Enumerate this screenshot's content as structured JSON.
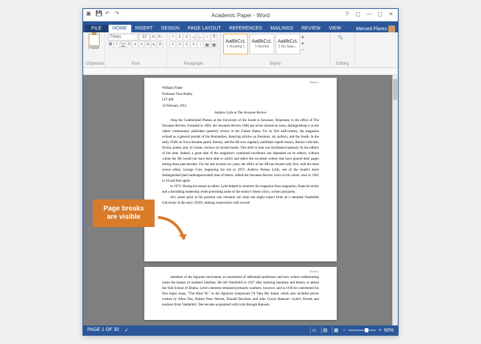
{
  "window": {
    "title": "Academic Paper - Word",
    "user": "Merced Flores"
  },
  "tabs": [
    "FILE",
    "HOME",
    "INSERT",
    "DESIGN",
    "PAGE LAYOUT",
    "REFERENCES",
    "MAILINGS",
    "REVIEW",
    "VIEW"
  ],
  "ribbon": {
    "clipboard": {
      "paste": "Paste",
      "label": "Clipboard"
    },
    "font": {
      "name": "Times",
      "size": "12",
      "label": "Font"
    },
    "paragraph": {
      "label": "Paragraph"
    },
    "styles": {
      "items": [
        {
          "sample": "AaBbCcL",
          "name": "1 Heading 1"
        },
        {
          "sample": "AaBbCcL",
          "name": "1 Normal"
        },
        {
          "sample": "AaBbCcL",
          "name": "1 No Spac..."
        }
      ],
      "label": "Styles"
    },
    "editing": {
      "label": "Editing"
    }
  },
  "document": {
    "folio1": "Fisher 1",
    "folio2": "Fisher 2",
    "header": [
      "William Fisher",
      "Professor Tom Shelby",
      "LIT 498",
      "12 February 2013"
    ],
    "title_prefix": "Andrew Lytle at ",
    "title_italic": "The Sewanee Review",
    "body1": "Atop the Cumberland Plateau at the University of the South in Sewanee, Tennessee, is the office of The Sewanee Review. Founded in 1892, the Sewanee Review (SR) has never missed an issue, distinguishing it as the oldest continuously published quarterly review in the United States. For its first half-century, the magazine existed as a general journal of the Humanities, featuring articles on literature, art, politics, and the South. In the early 1940s its focus became purely literary, and the SR now regularly publishes superb essays, literary criticism, fiction, poetry and, of course, reviews of current books. This shift in tone was facilitated expressly by the editors of the time. Indeed, a great deal of the magazine's continued excellence has depended on its editors, without whom the SR would not have been able to solicit and select the excellent writers that have graced their pages during these past decades. For the last seventy-six years, the office of the SR has housed only five, with the most recent editor, George Core, beginning his run in 1973. Andrew Nelson Lytle, one of the South's more distinguished (and underappreciated) men of letters, edited the Sewanee Review twice in his career, once in 1942 to 44 and then again",
    "body1b": " to 1973. During his tenure as editor, Lytle helped to resurrect the magazine from stagnation, financial straits and a dwindling readership while presenting some of the ountry's finest critics, writers and poets.",
    "body1c": "tle's career prior to his position was certainly not what one might expect from an e attended Vanderbilt University in the early 1920's, making connections with several",
    "body2": "members of the Agrarian movement, an assortment of influential professors and new writers collaborating under the banner of southern idealism. He left Vanderbilt in 1927 after studying literature and history to attend the Yale School of Drama. Lytle's interests remained primarily southern, however, and in 1930 he contributed his first major essay, \"The Hind Tit,\" to the Agrarian symposium I'll Take My Stand, which also included pieces written by Allen Tate, Robert Penn Warren, Donald Davidson and John Crowe Ransom—Lytle's friends and teachers from Vanderbilt. Tate became acquainted with Lytle through Ransom."
  },
  "statusbar": {
    "page": "PAGE 1 OF 30",
    "zoom": "60%"
  },
  "callout": {
    "line1": "Page breaks",
    "line2": "are visible"
  }
}
